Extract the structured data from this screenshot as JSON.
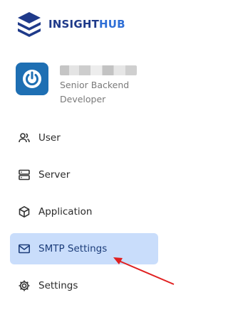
{
  "brand": {
    "name_part1": "INSIGHT",
    "name_part2": "HUB",
    "logo_icon": "stacked-layers-logo"
  },
  "profile": {
    "name": "redacted",
    "role_line1": "Senior Backend",
    "role_line2": "Developer",
    "avatar_icon": "power-icon"
  },
  "nav": {
    "items": [
      {
        "label": "User",
        "icon": "users-icon"
      },
      {
        "label": "Server",
        "icon": "server-icon"
      },
      {
        "label": "Application",
        "icon": "cube-icon"
      },
      {
        "label": "SMTP Settings",
        "icon": "mail-icon",
        "active": true
      },
      {
        "label": "Settings",
        "icon": "gear-icon"
      }
    ]
  },
  "colors": {
    "accent": "#1f3a8a",
    "accent_light": "#2f6fd6",
    "active_bg": "#c9ddfb",
    "avatar_bg": "#1e6fb3",
    "annotation_arrow": "#e02020"
  }
}
